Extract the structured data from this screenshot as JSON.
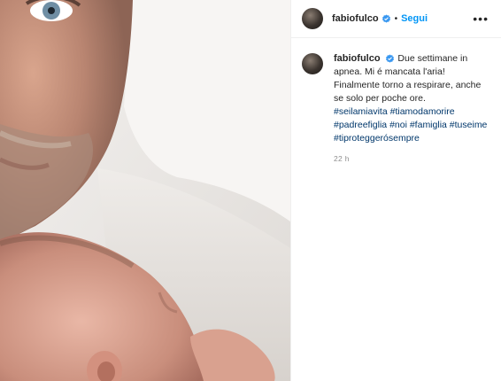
{
  "post": {
    "username": "fabiofulco",
    "separator": "•",
    "follow_label": "Segui",
    "more_label": "•••",
    "verified_icon": "verified-badge-icon",
    "caption": {
      "username": "fabiofulco",
      "text": "Due settimane in apnea. Mi é mancata l'aria! Finalmente torno a respirare, anche se solo per poche ore.",
      "hashtags": [
        "#seilamiavita",
        "#tiamodamorire",
        "#padreefiglia",
        "#noi",
        "#famiglia",
        "#tuseime",
        "#tiproteggerósempre"
      ],
      "time": "22 h"
    }
  },
  "colors": {
    "link": "#0095f6",
    "hashtag": "#00376b",
    "muted": "#8e8e8e",
    "verified": "#3897f0"
  }
}
